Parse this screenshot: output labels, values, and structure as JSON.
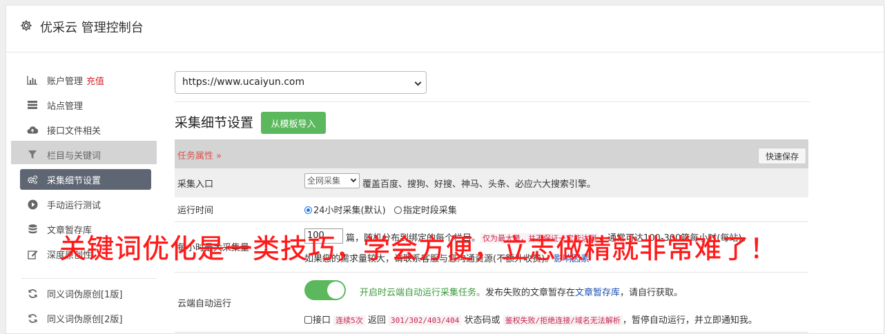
{
  "header": {
    "title": "优采云 管理控制台",
    "icon": "gear-icon"
  },
  "sidebar": {
    "items": [
      {
        "label": "账户管理",
        "extra": "充值",
        "icon": "bar-chart-icon"
      },
      {
        "label": "站点管理",
        "icon": "server-icon"
      },
      {
        "label": "接口文件相关",
        "icon": "cloud-upload-icon"
      },
      {
        "label": "栏目与关键词",
        "icon": "filter-icon"
      },
      {
        "label": "采集细节设置",
        "icon": "gears-icon",
        "active": true
      },
      {
        "label": "手动运行测试",
        "icon": "play-icon"
      },
      {
        "label": "文章暂存库",
        "icon": "database-icon"
      },
      {
        "label": "深度原创性",
        "icon": "edit-icon"
      },
      {
        "label": "同义词伪原创[1版]",
        "icon": "refresh-icon"
      },
      {
        "label": "同义词伪原创[2版]",
        "icon": "refresh-icon"
      }
    ]
  },
  "main": {
    "site_select": "https://www.ucaiyun.com",
    "section_title": "采集细节设置",
    "import_button": "从模板导入",
    "task_attr": "任务属性 »",
    "quick_save": "快速保存",
    "rows": {
      "entry": {
        "label": "采集入口",
        "select": "全网采集",
        "desc": "覆盖百度、搜狗、好搜、神马、头条、必应六大搜索引擎。"
      },
      "runtime": {
        "label": "运行时间",
        "opt1": "24小时采集(默认)",
        "opt2": "指定时段采集"
      },
      "max": {
        "label": "每小时最大采集量",
        "value": "100",
        "text1": "篇，随机分布到绑定的每个栏目。",
        "code1": "仅为最大量，并不保证一定能达到",
        "text2": "，通常可达100-300篇每小时(每站)。",
        "text3": "如果您的需求量较大，请联系客服与您沟通资源(不额外收费)。",
        "link": "影响因素"
      },
      "cloud": {
        "label": "云端自动运行",
        "green": "开启时云端自动运行采集任务。",
        "text1": "发布失败的文章暂存在",
        "link": "文章暂存库",
        "text2": "，请自行获取。",
        "cb_label": "接口",
        "code1": "连续5次",
        "text3": " 返回 ",
        "code2": "301/302/403/404",
        "text4": " 状态码或 ",
        "code3": "鉴权失败/拒绝连接/域名无法解析",
        "text5": "，暂停自动运行，并立即通知我。"
      }
    }
  },
  "overlay_text": "关键词优化是一类技巧，学会方便，立志做精就非常难了！"
}
